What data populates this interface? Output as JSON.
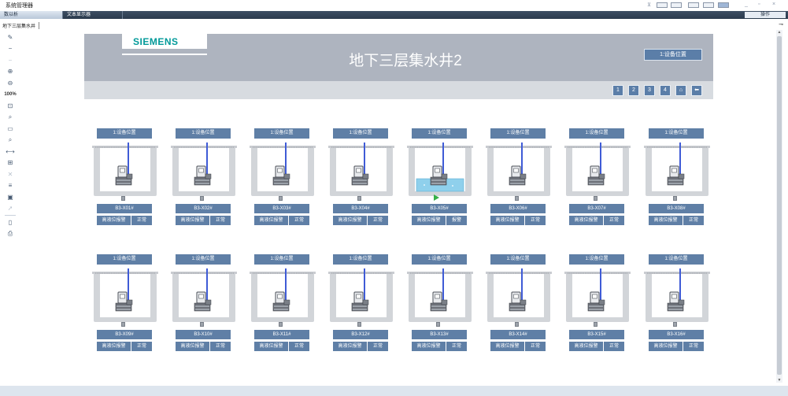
{
  "window": {
    "title": "系统管理器"
  },
  "tabs": [
    {
      "label": "数以析"
    },
    {
      "label": "文本显示器"
    }
  ],
  "operation_label": "操作",
  "subtab": "地下三层集水井",
  "toolbar": {
    "zoom_label": "100%"
  },
  "header": {
    "logo": "SIEMENS",
    "title": "地下三层集水井2",
    "button": "1:设备位置"
  },
  "nav": {
    "pages": [
      "1",
      "2",
      "3",
      "4"
    ],
    "home_icon": "home-icon",
    "back_icon": "back-arrow-icon"
  },
  "units_row1": [
    {
      "pos": "1:设备位置",
      "name": "B3-X01#",
      "alarm": "高液位报警",
      "state": "正常",
      "active": false
    },
    {
      "pos": "1:设备位置",
      "name": "B3-X02#",
      "alarm": "高液位报警",
      "state": "正常",
      "active": false
    },
    {
      "pos": "1:设备位置",
      "name": "B3-X03#",
      "alarm": "高液位报警",
      "state": "正常",
      "active": false
    },
    {
      "pos": "1:设备位置",
      "name": "B3-X04#",
      "alarm": "高液位报警",
      "state": "正常",
      "active": false
    },
    {
      "pos": "1:设备位置",
      "name": "B3-X05#",
      "alarm": "高液位报警",
      "state": "报警",
      "active": true
    },
    {
      "pos": "1:设备位置",
      "name": "B3-X06#",
      "alarm": "高液位报警",
      "state": "正常",
      "active": false
    },
    {
      "pos": "1:设备位置",
      "name": "B3-X07#",
      "alarm": "高液位报警",
      "state": "正常",
      "active": false
    },
    {
      "pos": "1:设备位置",
      "name": "B3-X08#",
      "alarm": "高液位报警",
      "state": "正常",
      "active": false
    }
  ],
  "units_row2": [
    {
      "pos": "1:设备位置",
      "name": "B3-X09#",
      "alarm": "高液位报警",
      "state": "正常",
      "active": false
    },
    {
      "pos": "1:设备位置",
      "name": "B3-X10#",
      "alarm": "高液位报警",
      "state": "正常",
      "active": false
    },
    {
      "pos": "1:设备位置",
      "name": "B3-X11#",
      "alarm": "高液位报警",
      "state": "正常",
      "active": false
    },
    {
      "pos": "1:设备位置",
      "name": "B3-X12#",
      "alarm": "高液位报警",
      "state": "正常",
      "active": false
    },
    {
      "pos": "1:设备位置",
      "name": "B3-X13#",
      "alarm": "高液位报警",
      "state": "正常",
      "active": false
    },
    {
      "pos": "1:设备位置",
      "name": "B3-X14#",
      "alarm": "高液位报警",
      "state": "正常",
      "active": false
    },
    {
      "pos": "1:设备位置",
      "name": "B3-X15#",
      "alarm": "高液位报警",
      "state": "正常",
      "active": false
    },
    {
      "pos": "1:设备位置",
      "name": "B3-X16#",
      "alarm": "高液位报警",
      "state": "正常",
      "active": false
    }
  ],
  "colors": {
    "accent": "#5f7fa6",
    "header": "#aeb4bf",
    "water": "#8fd0ec",
    "run": "#35b047",
    "logo": "#009999"
  }
}
